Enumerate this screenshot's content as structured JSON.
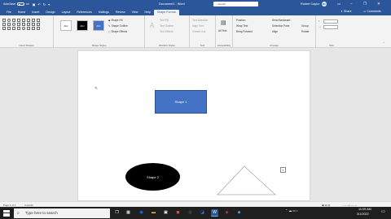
{
  "titlebar": {
    "autosave_label": "AutoSave",
    "autosave_state": "Off",
    "doc_title": "Document1 - Word",
    "search_placeholder": "Search",
    "user_name": "Robert Cayko",
    "avatar_initials": "RC"
  },
  "tabs": [
    "File",
    "Home",
    "Insert",
    "Design",
    "Layout",
    "References",
    "Mailings",
    "Review",
    "View",
    "Help",
    "Shape Format"
  ],
  "active_tab": "Shape Format",
  "share_label": "Share",
  "comments_label": "Comments",
  "ribbon": {
    "insert_shapes_label": "Insert Shapes",
    "style_thumbs": [
      "Abc",
      "Abc",
      "Abc"
    ],
    "shape_fill": "Shape Fill",
    "shape_outline": "Shape Outline",
    "shape_effects": "Shape Effects",
    "shape_styles_label": "Shape Styles",
    "text_fill": "Text Fill",
    "text_outline": "Text Outline",
    "text_effects": "Text Effects",
    "wordart_label": "WordArt Styles",
    "text_direction": "Text Direction",
    "align_text": "Align Text",
    "create_link": "Create Link",
    "text_label": "Text",
    "alt_text": "Alt Text",
    "accessibility_label": "Accessibility",
    "position": "Position",
    "wrap_text": "Wrap Text",
    "bring_forward": "Bring Forward",
    "send_backward": "Send Backward",
    "selection_pane": "Selection Pane",
    "align": "Align",
    "group": "Group",
    "rotate": "Rotate",
    "arrange_label": "Arrange",
    "size_label": "Size"
  },
  "document": {
    "shape1_text": "Shape 1",
    "shape2_text": "Shape 2"
  },
  "status": {
    "page": "Page 1 of 1",
    "words": "0 words"
  },
  "taskbar": {
    "search_placeholder": "Type here to search",
    "time": "11:09 AM",
    "date": "3/1/2022"
  },
  "colors": {
    "word_blue": "#2b579a",
    "shape1_fill": "#4472c4",
    "shape2_fill": "#000000"
  }
}
